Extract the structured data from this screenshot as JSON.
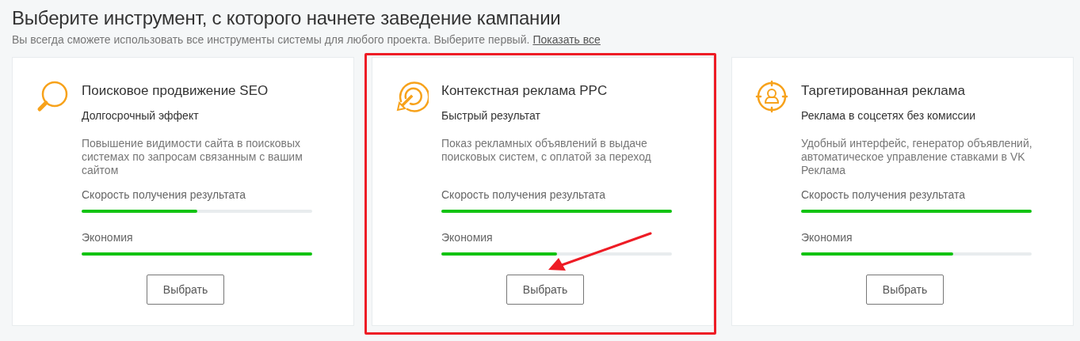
{
  "heading": "Выберите инструмент, с которого начнете заведение кампании",
  "subtitle": {
    "text": "Вы всегда сможете использовать все инструменты системы для любого проекта. Выберите первый.",
    "link": "Показать все"
  },
  "cards": [
    {
      "title": "Поисковое продвижение SEO",
      "tagline": "Долгосрочный эффект",
      "description": "Повышение видимости сайта в поисковых системах по запросам связанным с вашим сайтом",
      "highlighted": false,
      "meters": [
        {
          "label": "Скорость получения результата",
          "level": 0.5
        },
        {
          "label": "Экономия",
          "level": 1
        }
      ],
      "button": "Выбрать"
    },
    {
      "title": "Контекстная реклама PPC",
      "tagline": "Быстрый результат",
      "description": "Показ рекламных объявлений в выдаче поисковых систем, с оплатой за переход",
      "highlighted": true,
      "meters": [
        {
          "label": "Скорость получения результата",
          "level": 1
        },
        {
          "label": "Экономия",
          "level": 0.5
        }
      ],
      "button": "Выбрать"
    },
    {
      "title": "Таргетированная реклама",
      "tagline": "Реклама в соцсетях без комиссии",
      "description": "Удобный интерфейс, генератор объявлений, автоматическое управление ставками в VK Реклама",
      "highlighted": false,
      "meters": [
        {
          "label": "Скорость получения результата",
          "level": 1
        },
        {
          "label": "Экономия",
          "level": 0.66
        }
      ],
      "button": "Выбрать"
    }
  ]
}
